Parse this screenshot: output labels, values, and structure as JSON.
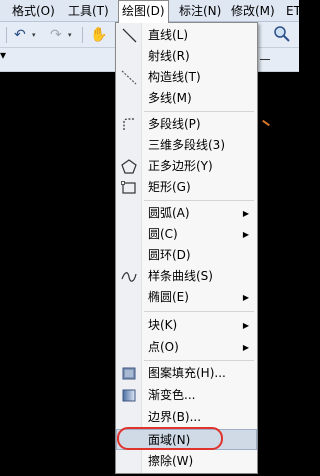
{
  "menubar": {
    "items": [
      {
        "label": "格式(O)"
      },
      {
        "label": "工具(T)"
      },
      {
        "label": "绘图(D)"
      },
      {
        "label": "标注(N)"
      },
      {
        "label": "修改(M)"
      },
      {
        "label": "ET"
      }
    ]
  },
  "draw_menu": {
    "items": [
      {
        "label": "直线(L)",
        "icon": "line-icon"
      },
      {
        "label": "射线(R)",
        "icon": ""
      },
      {
        "label": "构造线(T)",
        "icon": "xline-icon"
      },
      {
        "label": "多线(M)",
        "icon": ""
      },
      {
        "label": "多段线(P)",
        "icon": "polyline-icon"
      },
      {
        "label": "三维多段线(3)",
        "icon": ""
      },
      {
        "label": "正多边形(Y)",
        "icon": "polygon-icon"
      },
      {
        "label": "矩形(G)",
        "icon": "rectangle-icon"
      },
      {
        "label": "圆弧(A)",
        "icon": "",
        "submenu": true
      },
      {
        "label": "圆(C)",
        "icon": "",
        "submenu": true
      },
      {
        "label": "圆环(D)",
        "icon": ""
      },
      {
        "label": "样条曲线(S)",
        "icon": "spline-icon"
      },
      {
        "label": "椭圆(E)",
        "icon": "",
        "submenu": true
      },
      {
        "label": "块(K)",
        "icon": "",
        "submenu": true
      },
      {
        "label": "点(O)",
        "icon": "",
        "submenu": true
      },
      {
        "label": "图案填充(H)...",
        "icon": "hatch-icon"
      },
      {
        "label": "渐变色...",
        "icon": "gradient-icon"
      },
      {
        "label": "边界(B)...",
        "icon": ""
      },
      {
        "label": "面域(N)",
        "icon": "",
        "highlighted": true
      },
      {
        "label": "擦除(W)",
        "icon": ""
      }
    ],
    "submenu_arrow": "▶"
  },
  "toolbar": {
    "undo_icon": "↶",
    "redo_icon": "↷",
    "pan_icon": "✋",
    "dropdown_icon": "▾"
  }
}
